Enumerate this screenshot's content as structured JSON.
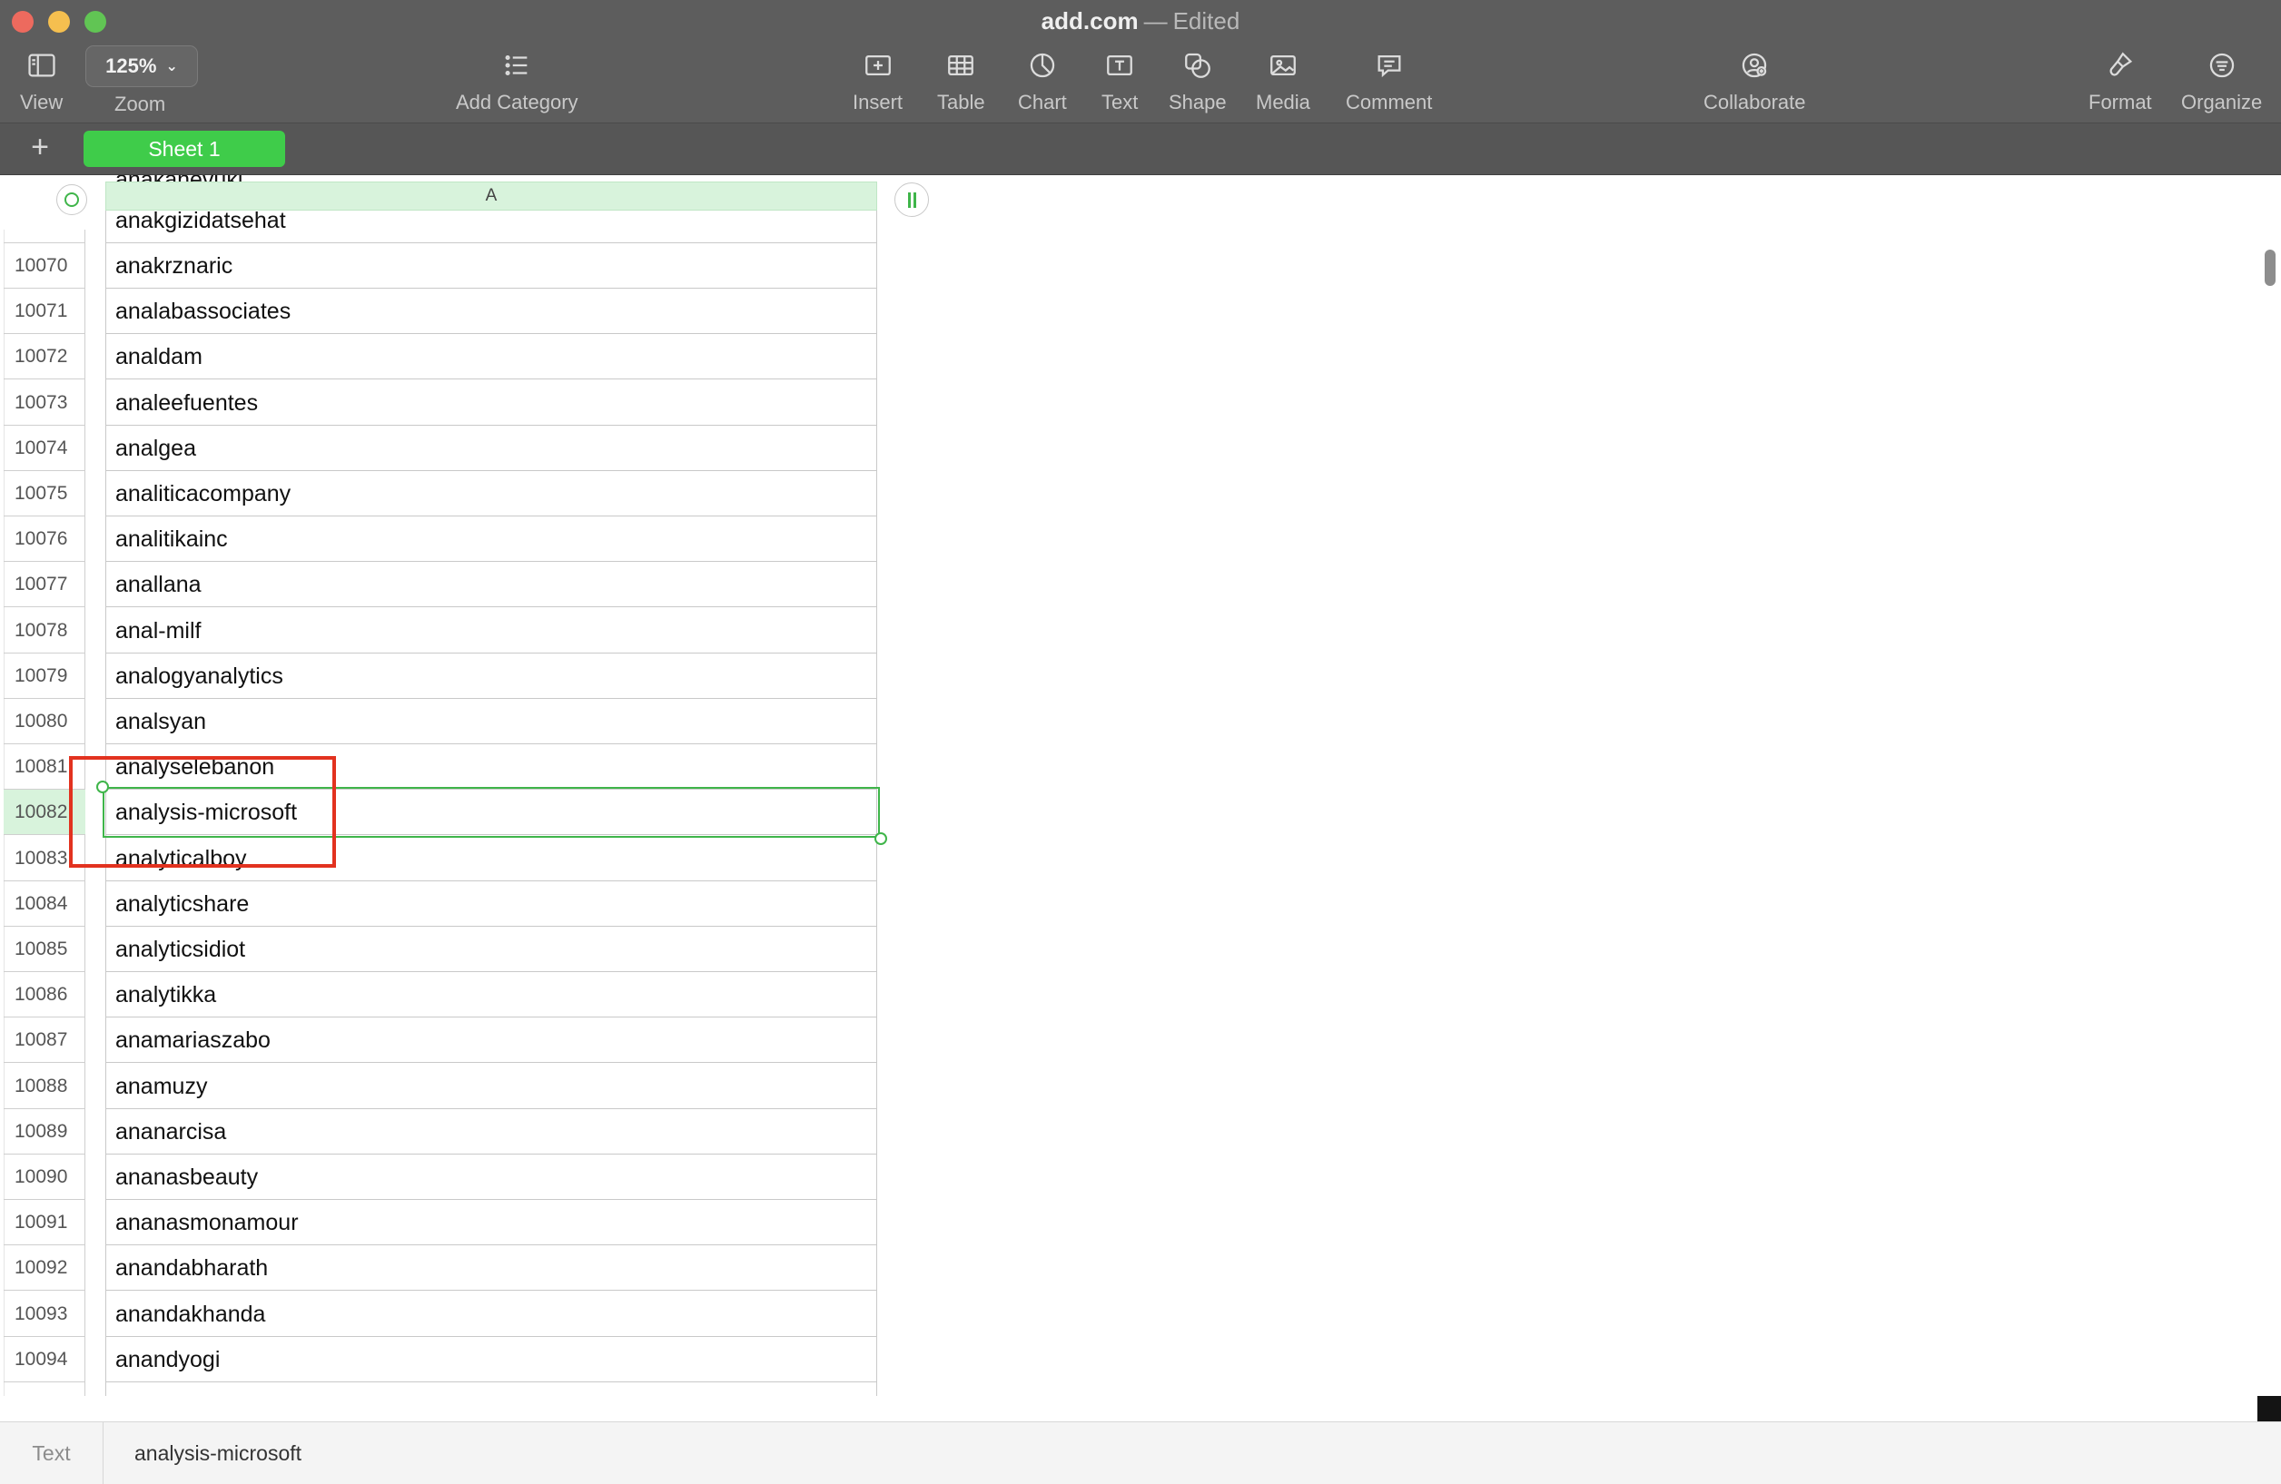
{
  "window": {
    "title": "add.com",
    "separator": "—",
    "status": "Edited"
  },
  "toolbar": {
    "view": {
      "label": "View",
      "icon": "sidebar-icon"
    },
    "zoom": {
      "label": "Zoom",
      "value": "125%"
    },
    "add_category": {
      "label": "Add Category",
      "icon": "list-icon"
    },
    "insert": {
      "label": "Insert",
      "icon": "insert-plus-icon"
    },
    "table": {
      "label": "Table",
      "icon": "table-icon"
    },
    "chart": {
      "label": "Chart",
      "icon": "pie-chart-icon"
    },
    "text": {
      "label": "Text",
      "icon": "text-box-icon"
    },
    "shape": {
      "label": "Shape",
      "icon": "shape-icon"
    },
    "media": {
      "label": "Media",
      "icon": "photo-icon"
    },
    "comment": {
      "label": "Comment",
      "icon": "comment-icon"
    },
    "collaborate": {
      "label": "Collaborate",
      "icon": "person-plus-icon"
    },
    "format": {
      "label": "Format",
      "icon": "paintbrush-icon"
    },
    "organize": {
      "label": "Organize",
      "icon": "filter-icon"
    }
  },
  "sheets": {
    "add_icon": "+",
    "active": "Sheet 1"
  },
  "table": {
    "column_header": "A",
    "top_partial_cell": "anakanevuki",
    "first_visible_cell": "anakgizidatsehat",
    "rows": [
      {
        "num": "10070",
        "value": "anakrznaric"
      },
      {
        "num": "10071",
        "value": "analabassociates"
      },
      {
        "num": "10072",
        "value": "analdam"
      },
      {
        "num": "10073",
        "value": "analeefuentes"
      },
      {
        "num": "10074",
        "value": "analgea"
      },
      {
        "num": "10075",
        "value": "analiticacompany"
      },
      {
        "num": "10076",
        "value": "analitikainc"
      },
      {
        "num": "10077",
        "value": "anallana"
      },
      {
        "num": "10078",
        "value": "anal-milf"
      },
      {
        "num": "10079",
        "value": "analogyanalytics"
      },
      {
        "num": "10080",
        "value": "analsyan"
      },
      {
        "num": "10081",
        "value": "analyselebanon"
      },
      {
        "num": "10082",
        "value": "analysis-microsoft"
      },
      {
        "num": "10083",
        "value": "analyticalboy"
      },
      {
        "num": "10084",
        "value": "analyticshare"
      },
      {
        "num": "10085",
        "value": "analyticsidiot"
      },
      {
        "num": "10086",
        "value": "analytikka"
      },
      {
        "num": "10087",
        "value": "anamariaszabo"
      },
      {
        "num": "10088",
        "value": "anamuzy"
      },
      {
        "num": "10089",
        "value": "ananarcisa"
      },
      {
        "num": "10090",
        "value": "ananasbeauty"
      },
      {
        "num": "10091",
        "value": "ananasmonamour"
      },
      {
        "num": "10092",
        "value": "anandabharath"
      },
      {
        "num": "10093",
        "value": "anandakhanda"
      },
      {
        "num": "10094",
        "value": "anandyogi"
      }
    ],
    "selected_row": "10082"
  },
  "formula_bar": {
    "kind": "Text",
    "value": "analysis-microsoft"
  },
  "colors": {
    "toolbar": "#5d5d5d",
    "accent_green": "#3fcc4a",
    "selection_row": "#d8f3dc",
    "annotation": "#e2321f"
  }
}
